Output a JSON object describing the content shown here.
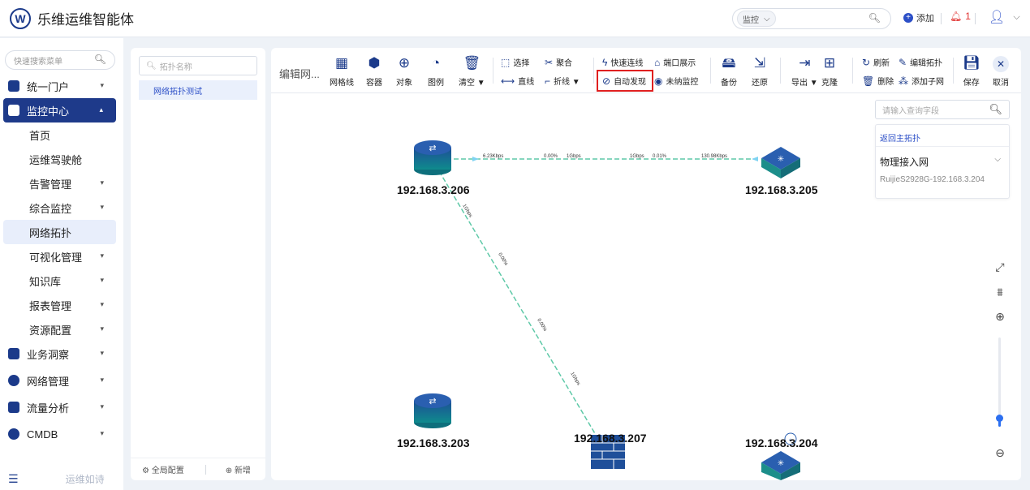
{
  "app": {
    "title": "乐维运维智能体",
    "logo_letter": "W"
  },
  "header": {
    "search_select": "监控",
    "add_label": "添加",
    "alert_count": "1"
  },
  "sidebar": {
    "search_placeholder": "快速搜索菜单",
    "items": [
      {
        "label": "统一门户",
        "icon": "home-icon",
        "expanded": false
      },
      {
        "label": "监控中心",
        "icon": "monitor-icon",
        "expanded": true,
        "active": true
      },
      {
        "label": "业务洞察",
        "icon": "insight-icon",
        "expanded": false
      },
      {
        "label": "网络管理",
        "icon": "globe-icon",
        "expanded": false
      },
      {
        "label": "流量分析",
        "icon": "traffic-icon",
        "expanded": false
      },
      {
        "label": "CMDB",
        "icon": "cmdb-icon",
        "expanded": false
      }
    ],
    "sub_items": [
      {
        "label": "首页",
        "has_children": false
      },
      {
        "label": "运维驾驶舱",
        "has_children": false
      },
      {
        "label": "告警管理",
        "has_children": true
      },
      {
        "label": "综合监控",
        "has_children": true
      },
      {
        "label": "网络拓扑",
        "has_children": false,
        "selected": true
      },
      {
        "label": "可视化管理",
        "has_children": true
      },
      {
        "label": "知识库",
        "has_children": true
      },
      {
        "label": "报表管理",
        "has_children": true
      },
      {
        "label": "资源配置",
        "has_children": true
      }
    ],
    "footer_motto": "运维如诗"
  },
  "topology_list": {
    "search_placeholder": "拓扑名称",
    "items": [
      "网络拓扑测试"
    ],
    "footer": {
      "global_config": "全局配置",
      "new": "新增"
    }
  },
  "toolbar": {
    "title": "编辑网...",
    "big_buttons": [
      {
        "label": "网格线",
        "icon": "grid-icon"
      },
      {
        "label": "容器",
        "icon": "container-icon"
      },
      {
        "label": "对象",
        "icon": "add-object-icon"
      },
      {
        "label": "图例",
        "icon": "legend-icon"
      },
      {
        "label": "清空 ▼",
        "icon": "clear-icon"
      }
    ],
    "row_top": [
      {
        "label": "选择",
        "icon": "select-icon"
      },
      {
        "label": "聚合",
        "icon": "aggregate-icon"
      },
      {
        "label": "快速连线",
        "icon": "quick-link-icon"
      },
      {
        "label": "端口展示",
        "icon": "port-display-icon"
      }
    ],
    "row_bottom": [
      {
        "label": "直线",
        "icon": "line-icon"
      },
      {
        "label": "折线 ▼",
        "icon": "polyline-icon"
      },
      {
        "label": "自动发现",
        "icon": "auto-discover-icon"
      },
      {
        "label": "未纳监控",
        "icon": "unmonitored-icon"
      }
    ],
    "backup_buttons": [
      {
        "label": "备份",
        "icon": "backup-icon"
      },
      {
        "label": "还原",
        "icon": "restore-icon"
      }
    ],
    "export_buttons": [
      {
        "label": "导出 ▼",
        "icon": "export-icon"
      },
      {
        "label": "克隆",
        "icon": "clone-icon"
      }
    ],
    "edit_top": [
      {
        "label": "刷新",
        "icon": "refresh-icon"
      },
      {
        "label": "编辑拓扑",
        "icon": "edit-topology-icon"
      }
    ],
    "edit_bottom": [
      {
        "label": "删除",
        "icon": "delete-icon"
      },
      {
        "label": "添加子网",
        "icon": "add-subnet-icon"
      }
    ],
    "save_label": "保存",
    "cancel_label": "取消"
  },
  "topology": {
    "nodes": [
      {
        "id": "n206",
        "label": "192.168.3.206",
        "type": "router"
      },
      {
        "id": "n205",
        "label": "192.168.3.205",
        "type": "switch"
      },
      {
        "id": "n203",
        "label": "192.168.3.203",
        "type": "router"
      },
      {
        "id": "n207",
        "label": "192.168.3.207",
        "type": "firewall"
      },
      {
        "id": "n204",
        "label": "192.168.3.204",
        "type": "wireless-switch"
      }
    ],
    "links": [
      {
        "from": "n206",
        "to": "n205",
        "labels": [
          "6.23Kbps",
          "0.00%",
          "1Gbps",
          "1Gbps",
          "0.01%",
          "130.98Kbps"
        ]
      },
      {
        "from": "n206",
        "to": "n207",
        "labels": [
          "1Gbps",
          "0.00%",
          "0.00%",
          "1Gbps"
        ]
      }
    ]
  },
  "info_panel": {
    "search_placeholder": "请输入查询字段",
    "back_label": "返回主拓扑",
    "group_label": "物理接入网",
    "device_label": "RuijieS2928G-192.168.3.204"
  },
  "zoom": {
    "level": 0.1
  },
  "colors": {
    "primary": "#1e3a8a",
    "accent": "#2c6ff0",
    "highlight": "#e02020",
    "link": "#5fc9a8"
  }
}
